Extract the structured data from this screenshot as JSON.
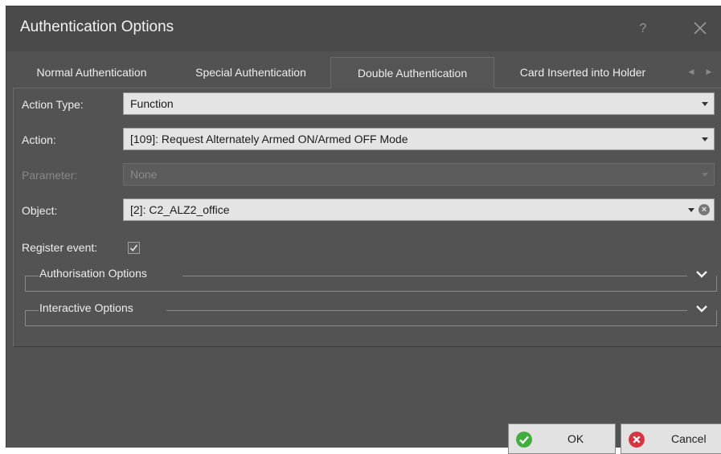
{
  "window": {
    "title": "Authentication Options",
    "help_label": "?"
  },
  "tabs": [
    {
      "label": "Normal Authentication",
      "active": false
    },
    {
      "label": "Special Authentication",
      "active": false
    },
    {
      "label": "Double Authentication",
      "active": true
    },
    {
      "label": "Card Inserted into Holder",
      "active": false
    }
  ],
  "form": {
    "action_type": {
      "label": "Action Type:",
      "value": "Function"
    },
    "action": {
      "label": "Action:",
      "value": "[109]: Request Alternately Armed ON/Armed OFF Mode"
    },
    "parameter": {
      "label": "Parameter:",
      "value": "None",
      "enabled": false
    },
    "object": {
      "label": "Object:",
      "value": "[2]: C2_ALZ2_office"
    },
    "register_event": {
      "label": "Register event:",
      "checked": true
    }
  },
  "groups": {
    "authorisation": {
      "label": "Authorisation Options",
      "expanded": false
    },
    "interactive": {
      "label": "Interactive Options",
      "expanded": false
    }
  },
  "buttons": {
    "ok_label": "OK",
    "cancel_label": "Cancel"
  },
  "colors": {
    "ok_icon": "#3fae3b",
    "cancel_icon": "#d9343e",
    "dialog_bg": "#525252",
    "title_bg": "#4a4a4a"
  },
  "icons": {
    "close": "close-x-icon",
    "ok": "check-circle-icon",
    "cancel": "x-circle-icon",
    "expand": "chevron-down-icon"
  }
}
